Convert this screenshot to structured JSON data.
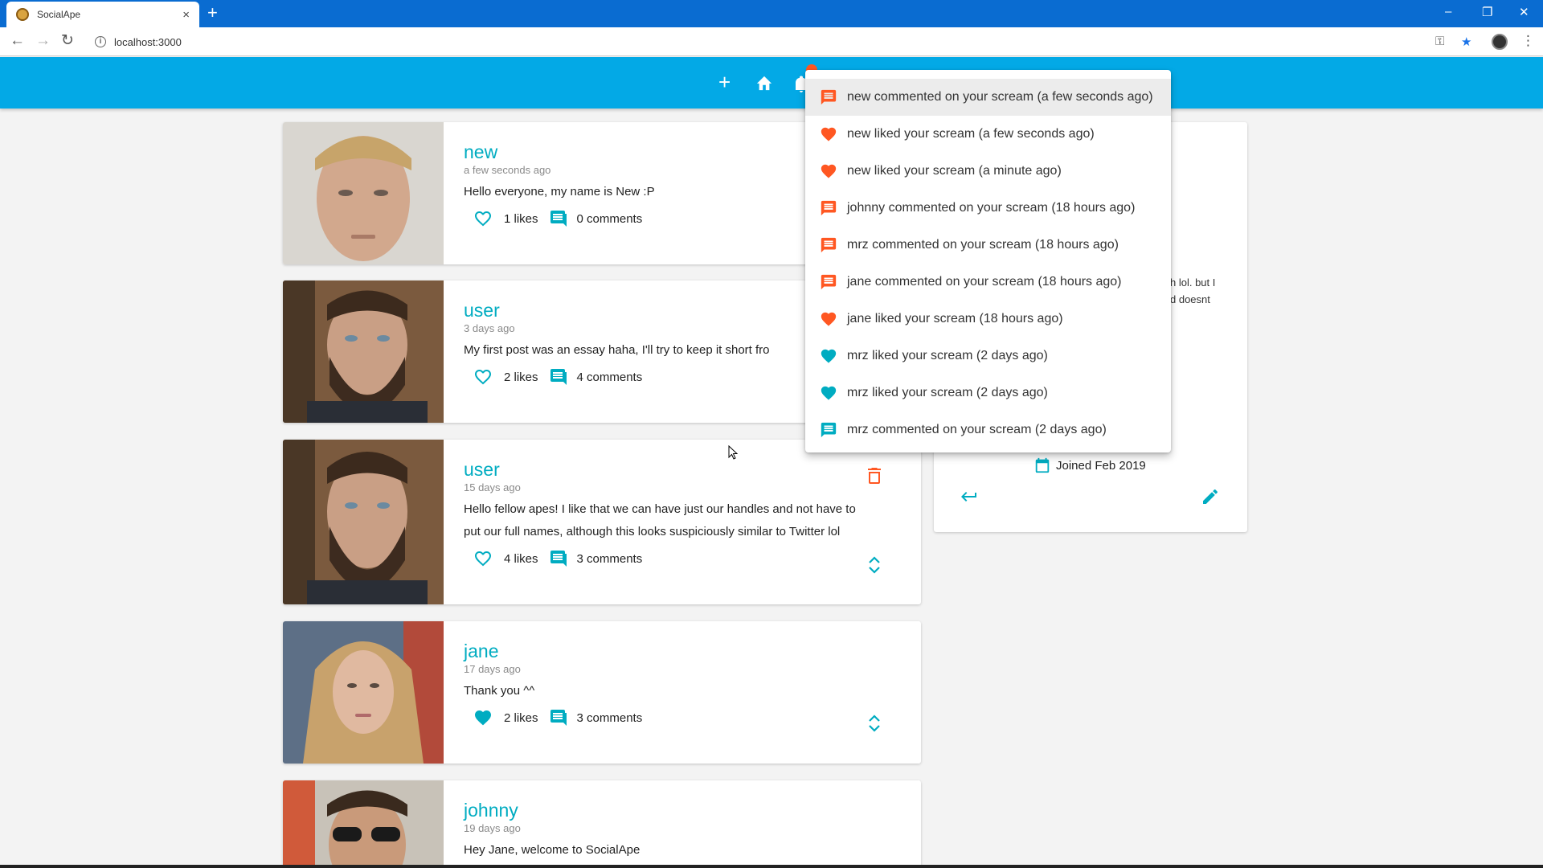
{
  "browser": {
    "tab_title": "SocialApe",
    "tab_close": "×",
    "new_tab": "+",
    "url": "localhost:3000",
    "info": "i",
    "back": "←",
    "forward": "→",
    "reload": "↻",
    "key": "⚿",
    "star": "★",
    "menu": "⋮",
    "minimize": "–",
    "restore": "❐",
    "close": "✕"
  },
  "appbar": {
    "add": "+",
    "home": "⌂"
  },
  "colors": {
    "primary": "#00acc1",
    "appbar": "#03a9e6",
    "notification_orange": "#ff5722",
    "notification_blue": "#00acc1"
  },
  "posts": [
    {
      "handle": "new",
      "time": "a few seconds ago",
      "body": "Hello everyone, my name is New :P",
      "likes": "1 likes",
      "comments": "0 comments",
      "liked": false
    },
    {
      "handle": "user",
      "time": "3 days ago",
      "body": "My first post was an essay haha, I'll try to keep it short fro",
      "likes": "2 likes",
      "comments": "4 comments",
      "liked": false
    },
    {
      "handle": "user",
      "time": "15 days ago",
      "body_line1": "Hello fellow apes! I like that we can have just our handles and not have to",
      "body_line2": "put our full names, although this looks suspiciously similar to Twitter lol",
      "likes": "4 likes",
      "comments": "3 comments",
      "liked": false
    },
    {
      "handle": "jane",
      "time": "17 days ago",
      "body": "Thank you ^^",
      "likes": "2 likes",
      "comments": "3 comments",
      "liked": true
    },
    {
      "handle": "johnny",
      "time": "19 days ago",
      "body": "Hey Jane, welcome to SocialApe"
    }
  ],
  "profile": {
    "bio_line1": "h lol. but I",
    "bio_line2": "d doesnt",
    "joined": "Joined Feb 2019"
  },
  "notifications": [
    {
      "text": "new commented on your scream (a few seconds ago)",
      "icon": "comment-icon",
      "read": false
    },
    {
      "text": "new liked your scream (a few seconds ago)",
      "icon": "heart-icon",
      "read": false
    },
    {
      "text": "new liked your scream (a minute ago)",
      "icon": "heart-icon",
      "read": false
    },
    {
      "text": "johnny commented on your scream (18 hours ago)",
      "icon": "comment-icon",
      "read": false
    },
    {
      "text": "mrz commented on your scream (18 hours ago)",
      "icon": "comment-icon",
      "read": false
    },
    {
      "text": "jane commented on your scream (18 hours ago)",
      "icon": "comment-icon",
      "read": false
    },
    {
      "text": "jane liked your scream (18 hours ago)",
      "icon": "heart-icon",
      "read": false
    },
    {
      "text": "mrz liked your scream (2 days ago)",
      "icon": "heart-icon",
      "read": true
    },
    {
      "text": "mrz liked your scream (2 days ago)",
      "icon": "heart-icon",
      "read": true
    },
    {
      "text": "mrz commented on your scream (2 days ago)",
      "icon": "comment-icon",
      "read": true
    }
  ]
}
